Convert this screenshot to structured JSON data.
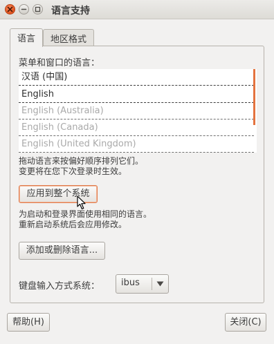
{
  "window": {
    "title": "语言支持"
  },
  "tabs": [
    {
      "label": "语言",
      "active": true
    },
    {
      "label": "地区格式",
      "active": false
    }
  ],
  "language_section": {
    "heading": "菜单和窗口的语言：",
    "languages": [
      {
        "label": "汉语 (中国)",
        "enabled": true
      },
      {
        "label": "English",
        "enabled": true
      },
      {
        "label": "English (Australia)",
        "enabled": false
      },
      {
        "label": "English (Canada)",
        "enabled": false
      },
      {
        "label": "English (United Kingdom)",
        "enabled": false
      }
    ],
    "hint_line1": "拖动语言来按偏好顺序排列它们。",
    "hint_line2": "变更将在您下次登录时生效。",
    "apply_button": "应用到整个系统",
    "apply_note_line1": "为启动和登录界面使用相同的语言。",
    "apply_note_line2": "重新启动系统后会应用修改。",
    "install_button": "添加或删除语言..."
  },
  "input_method": {
    "label": "键盘输入方式系统：",
    "selected": "ibus"
  },
  "footer": {
    "help_button": "帮助(H)",
    "close_button": "关闭(C)"
  },
  "colors": {
    "accent": "#e4733f",
    "close_button": "#e0531e"
  }
}
